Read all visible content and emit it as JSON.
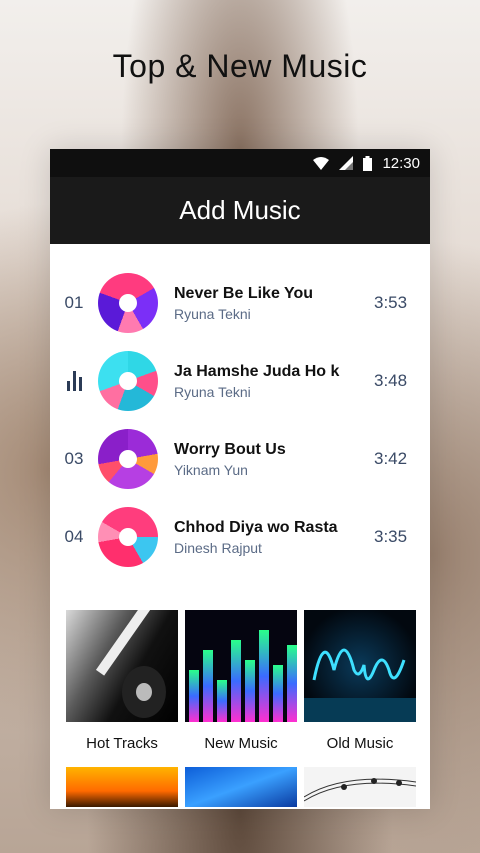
{
  "promo": {
    "title": "Top & New Music"
  },
  "status": {
    "time": "12:30"
  },
  "app_bar": {
    "title": "Add Music"
  },
  "tracks": [
    {
      "num": "01",
      "title": "Never Be Like You",
      "artist": "Ryuna Tekni",
      "duration": "3:53"
    },
    {
      "num": "",
      "title": "Ja Hamshe Juda Ho k",
      "artist": "Ryuna Tekni",
      "duration": "3:48",
      "playing": true
    },
    {
      "num": "03",
      "title": "Worry Bout Us",
      "artist": "Yiknam Yun",
      "duration": "3:42"
    },
    {
      "num": "04",
      "title": "Chhod Diya wo Rasta",
      "artist": "Dinesh Rajput",
      "duration": "3:35"
    }
  ],
  "categories": [
    {
      "label": "Hot Tracks"
    },
    {
      "label": "New Music"
    },
    {
      "label": "Old Music"
    }
  ],
  "icons": [
    "wifi-icon",
    "signal-icon",
    "battery-icon",
    "equalizer-icon"
  ]
}
